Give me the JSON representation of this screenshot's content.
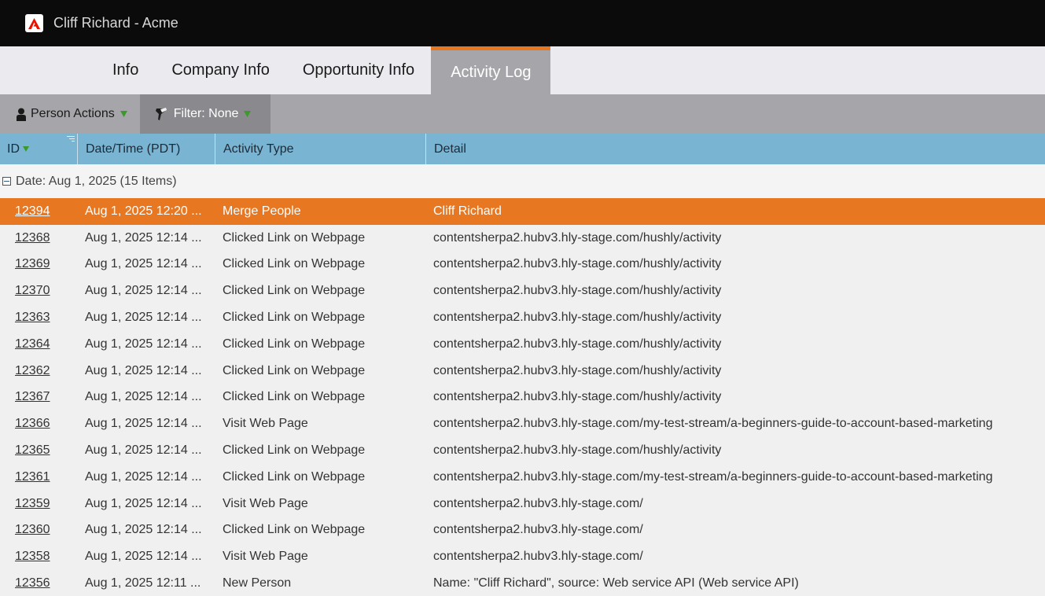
{
  "app": {
    "title": "Cliff Richard - Acme",
    "logo": "adobe-logo-icon",
    "accent": "#e87722"
  },
  "tabs": [
    {
      "label": "Info",
      "active": false
    },
    {
      "label": "Company Info",
      "active": false
    },
    {
      "label": "Opportunity Info",
      "active": false
    },
    {
      "label": "Activity Log",
      "active": true
    }
  ],
  "toolbar": {
    "person_actions": "Person Actions",
    "filter": "Filter: None"
  },
  "columns": {
    "id": "ID",
    "datetime": "Date/Time (PDT)",
    "type": "Activity Type",
    "detail": "Detail"
  },
  "group": {
    "label": "Date: Aug 1, 2025 (15 Items)"
  },
  "rows": [
    {
      "id": "12394",
      "datetime": "Aug 1, 2025 12:20 ...",
      "type": "Merge People",
      "detail": "Cliff Richard",
      "selected": true
    },
    {
      "id": "12368",
      "datetime": "Aug 1, 2025 12:14 ...",
      "type": "Clicked Link on Webpage",
      "detail": "contentsherpa2.hubv3.hly-stage.com/hushly/activity"
    },
    {
      "id": "12369",
      "datetime": "Aug 1, 2025 12:14 ...",
      "type": "Clicked Link on Webpage",
      "detail": "contentsherpa2.hubv3.hly-stage.com/hushly/activity"
    },
    {
      "id": "12370",
      "datetime": "Aug 1, 2025 12:14 ...",
      "type": "Clicked Link on Webpage",
      "detail": "contentsherpa2.hubv3.hly-stage.com/hushly/activity"
    },
    {
      "id": "12363",
      "datetime": "Aug 1, 2025 12:14 ...",
      "type": "Clicked Link on Webpage",
      "detail": "contentsherpa2.hubv3.hly-stage.com/hushly/activity"
    },
    {
      "id": "12364",
      "datetime": "Aug 1, 2025 12:14 ...",
      "type": "Clicked Link on Webpage",
      "detail": "contentsherpa2.hubv3.hly-stage.com/hushly/activity"
    },
    {
      "id": "12362",
      "datetime": "Aug 1, 2025 12:14 ...",
      "type": "Clicked Link on Webpage",
      "detail": "contentsherpa2.hubv3.hly-stage.com/hushly/activity"
    },
    {
      "id": "12367",
      "datetime": "Aug 1, 2025 12:14 ...",
      "type": "Clicked Link on Webpage",
      "detail": "contentsherpa2.hubv3.hly-stage.com/hushly/activity"
    },
    {
      "id": "12366",
      "datetime": "Aug 1, 2025 12:14 ...",
      "type": "Visit Web Page",
      "detail": "contentsherpa2.hubv3.hly-stage.com/my-test-stream/a-beginners-guide-to-account-based-marketing"
    },
    {
      "id": "12365",
      "datetime": "Aug 1, 2025 12:14 ...",
      "type": "Clicked Link on Webpage",
      "detail": "contentsherpa2.hubv3.hly-stage.com/hushly/activity"
    },
    {
      "id": "12361",
      "datetime": "Aug 1, 2025 12:14 ...",
      "type": "Clicked Link on Webpage",
      "detail": "contentsherpa2.hubv3.hly-stage.com/my-test-stream/a-beginners-guide-to-account-based-marketing"
    },
    {
      "id": "12359",
      "datetime": "Aug 1, 2025 12:14 ...",
      "type": "Visit Web Page",
      "detail": "contentsherpa2.hubv3.hly-stage.com/"
    },
    {
      "id": "12360",
      "datetime": "Aug 1, 2025 12:14 ...",
      "type": "Clicked Link on Webpage",
      "detail": "contentsherpa2.hubv3.hly-stage.com/"
    },
    {
      "id": "12358",
      "datetime": "Aug 1, 2025 12:14 ...",
      "type": "Visit Web Page",
      "detail": "contentsherpa2.hubv3.hly-stage.com/"
    },
    {
      "id": "12356",
      "datetime": "Aug 1, 2025 12:11 ...",
      "type": "New Person",
      "detail": "Name: \"Cliff Richard\", source: Web service API (Web service API)"
    }
  ]
}
